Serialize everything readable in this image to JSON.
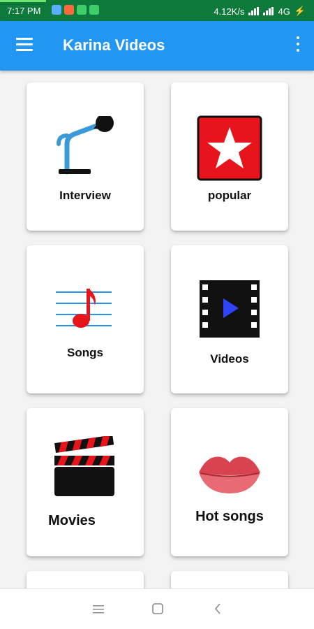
{
  "status_bar": {
    "time": "7:17 PM",
    "speed": "4.12K/s",
    "network": "4G"
  },
  "app_bar": {
    "title": "Karina Videos"
  },
  "categories": [
    {
      "label": "Interview",
      "icon": "microphone-icon"
    },
    {
      "label": "popular",
      "icon": "star-icon"
    },
    {
      "label": "Songs",
      "icon": "music-note-icon"
    },
    {
      "label": "Videos",
      "icon": "film-play-icon"
    },
    {
      "label": "Movies",
      "icon": "clapperboard-icon"
    },
    {
      "label": "Hot songs",
      "icon": "lips-icon"
    }
  ],
  "colors": {
    "status_bar": "#0d7a3b",
    "app_bar": "#2196f3",
    "card": "#ffffff",
    "background": "#f3f3f3"
  }
}
